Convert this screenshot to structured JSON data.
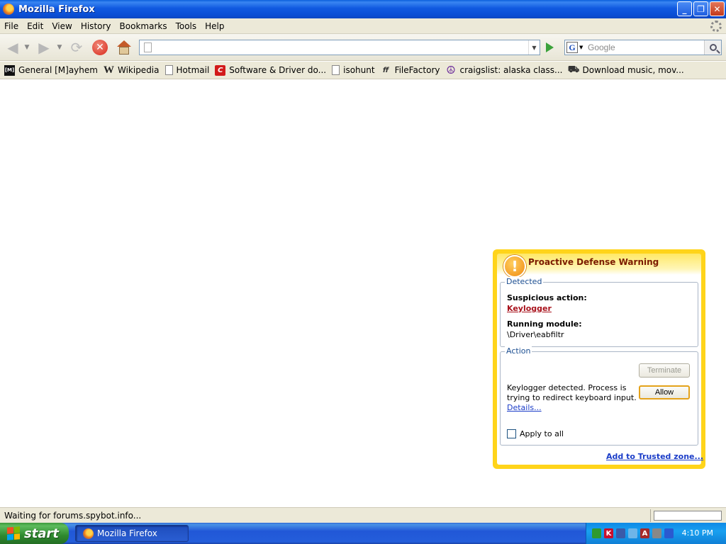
{
  "window": {
    "title": "Mozilla Firefox",
    "buttons": {
      "minimize": "_",
      "restore": "❐",
      "close": "✕"
    }
  },
  "menu": {
    "items": [
      "File",
      "Edit",
      "View",
      "History",
      "Bookmarks",
      "Tools",
      "Help"
    ]
  },
  "navbar": {
    "url_value": "",
    "search_engine": "G",
    "search_placeholder": "Google"
  },
  "bookmarks": [
    {
      "label": "General [M]ayhem",
      "icon": "gm-icon"
    },
    {
      "label": "Wikipedia",
      "icon": "wikipedia-icon"
    },
    {
      "label": "Hotmail",
      "icon": "page-icon"
    },
    {
      "label": "Software & Driver do...",
      "icon": "software-icon"
    },
    {
      "label": "isohunt",
      "icon": "page-icon"
    },
    {
      "label": "FileFactory",
      "icon": "filefactory-icon"
    },
    {
      "label": "craigslist: alaska class...",
      "icon": "peace-icon"
    },
    {
      "label": "Download music, mov...",
      "icon": "download-icon"
    }
  ],
  "popup": {
    "title": "Proactive Defense Warning",
    "detected_label": "Detected",
    "suspicious_label": "Suspicious action:",
    "suspicious_value": "Keylogger",
    "module_label": "Running module:",
    "module_value": "\\Driver\\eabfiltr",
    "action_label": "Action",
    "terminate_label": "Terminate",
    "allow_label": "Allow",
    "description": "Keylogger detected. Process is trying to redirect keyboard input.",
    "details_link": "Details...",
    "apply_all_label": "Apply to all",
    "trusted_link": "Add to Trusted zone...",
    "colors": {
      "frame": "#ffd41a",
      "title": "#7a1a00",
      "link": "#1a3cc8",
      "alert_link": "#a8121c"
    }
  },
  "status": {
    "text": "Waiting for forums.spybot.info..."
  },
  "taskbar": {
    "start_label": "start",
    "task_label": "Mozilla Firefox",
    "clock": "4:10 PM"
  }
}
